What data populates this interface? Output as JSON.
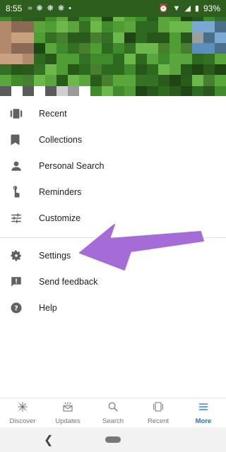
{
  "status": {
    "time": "8:55",
    "battery": "93%"
  },
  "menu": {
    "items": [
      {
        "label": "Recent",
        "icon": "recent-icon"
      },
      {
        "label": "Collections",
        "icon": "bookmark-icon"
      },
      {
        "label": "Personal Search",
        "icon": "person-icon"
      },
      {
        "label": "Reminders",
        "icon": "reminder-icon"
      },
      {
        "label": "Customize",
        "icon": "sliders-icon"
      },
      {
        "label": "Settings",
        "icon": "gear-icon"
      },
      {
        "label": "Send feedback",
        "icon": "feedback-icon"
      },
      {
        "label": "Help",
        "icon": "help-icon"
      }
    ]
  },
  "bottom_nav": [
    {
      "label": "Discover",
      "icon": "asterisk-icon"
    },
    {
      "label": "Updates",
      "icon": "updates-icon"
    },
    {
      "label": "Search",
      "icon": "search-icon"
    },
    {
      "label": "Recent",
      "icon": "recent-icon"
    },
    {
      "label": "More",
      "icon": "menu-icon",
      "active": true
    }
  ],
  "colors": {
    "accent": "#1a73e8",
    "arrow": "#a56cd8",
    "header_green": "#3b7a2a"
  }
}
